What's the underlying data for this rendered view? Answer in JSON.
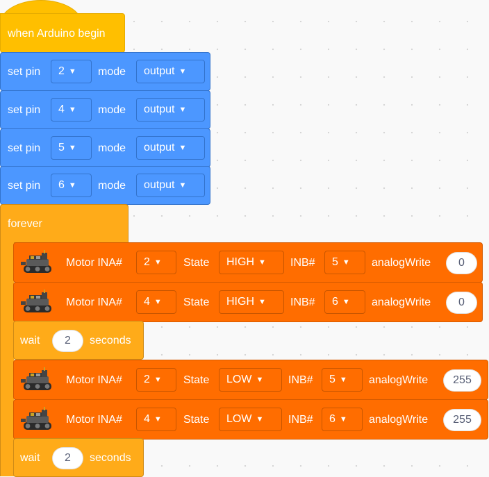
{
  "hat": {
    "label": "when Arduino begin"
  },
  "set_pin_blocks": [
    {
      "label": "set pin",
      "pin": "2",
      "mode_label": "mode",
      "mode": "output"
    },
    {
      "label": "set pin",
      "pin": "4",
      "mode_label": "mode",
      "mode": "output"
    },
    {
      "label": "set pin",
      "pin": "5",
      "mode_label": "mode",
      "mode": "output"
    },
    {
      "label": "set pin",
      "pin": "6",
      "mode_label": "mode",
      "mode": "output"
    }
  ],
  "forever": {
    "label": "forever"
  },
  "motor_blocks": [
    {
      "ina_label": "Motor INA#",
      "ina": "2",
      "state_label": "State",
      "state": "HIGH",
      "inb_label": "INB#",
      "inb": "5",
      "aw_label": "analogWrite",
      "aw": "0"
    },
    {
      "ina_label": "Motor INA#",
      "ina": "4",
      "state_label": "State",
      "state": "HIGH",
      "inb_label": "INB#",
      "inb": "6",
      "aw_label": "analogWrite",
      "aw": "0"
    },
    {
      "ina_label": "Motor INA#",
      "ina": "2",
      "state_label": "State",
      "state": "LOW",
      "inb_label": "INB#",
      "inb": "5",
      "aw_label": "analogWrite",
      "aw": "255"
    },
    {
      "ina_label": "Motor INA#",
      "ina": "4",
      "state_label": "State",
      "state": "LOW",
      "inb_label": "INB#",
      "inb": "6",
      "aw_label": "analogWrite",
      "aw": "255"
    }
  ],
  "wait_blocks": [
    {
      "label": "wait",
      "value": "2",
      "unit": "seconds"
    },
    {
      "label": "wait",
      "value": "2",
      "unit": "seconds"
    }
  ],
  "icons": {
    "dropdown": "caret-down-icon",
    "robot": "robot-car-icon"
  },
  "colors": {
    "hat": "#ffbf00",
    "pin": "#4c97ff",
    "control": "#ffab19",
    "motor": "#ff6d00"
  }
}
